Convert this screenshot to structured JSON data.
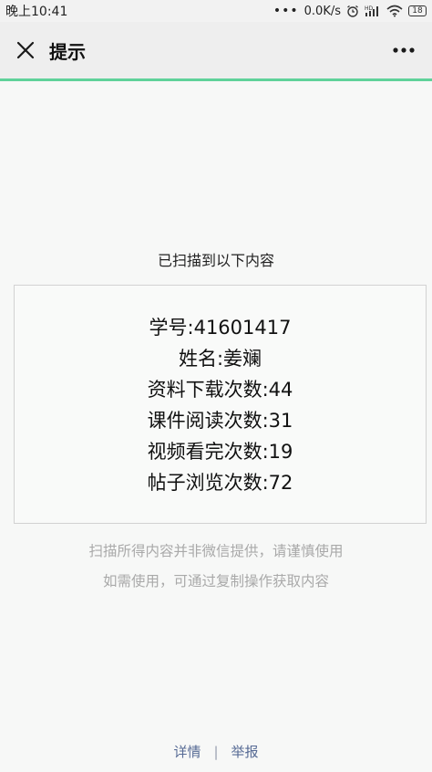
{
  "status_bar": {
    "time": "晚上10:41",
    "network_speed": "0.0K/s",
    "battery_level": "18",
    "icons": [
      "dots-icon",
      "alarm-icon",
      "hd-signal-icon",
      "signal-icon",
      "wifi-icon",
      "battery-icon"
    ]
  },
  "nav": {
    "title": "提示",
    "close_icon": "close-icon",
    "more_icon": "more-icon"
  },
  "main": {
    "heading": "已扫描到以下内容",
    "result_lines": [
      "学号:41601417",
      "姓名:姜斓",
      "资料下载次数:44",
      "课件阅读次数:31",
      "视频看完次数:19",
      "帖子浏览次数:72"
    ],
    "disclaimer_line1": "扫描所得内容并非微信提供，请谨慎使用",
    "disclaimer_line2": "如需使用，可通过复制操作获取内容"
  },
  "footer": {
    "details_link": "详情",
    "separator": "|",
    "report_link": "举报"
  },
  "colors": {
    "progress_accent": "#5fd29a",
    "link": "#576b95",
    "muted_text": "#a9a9a9"
  }
}
